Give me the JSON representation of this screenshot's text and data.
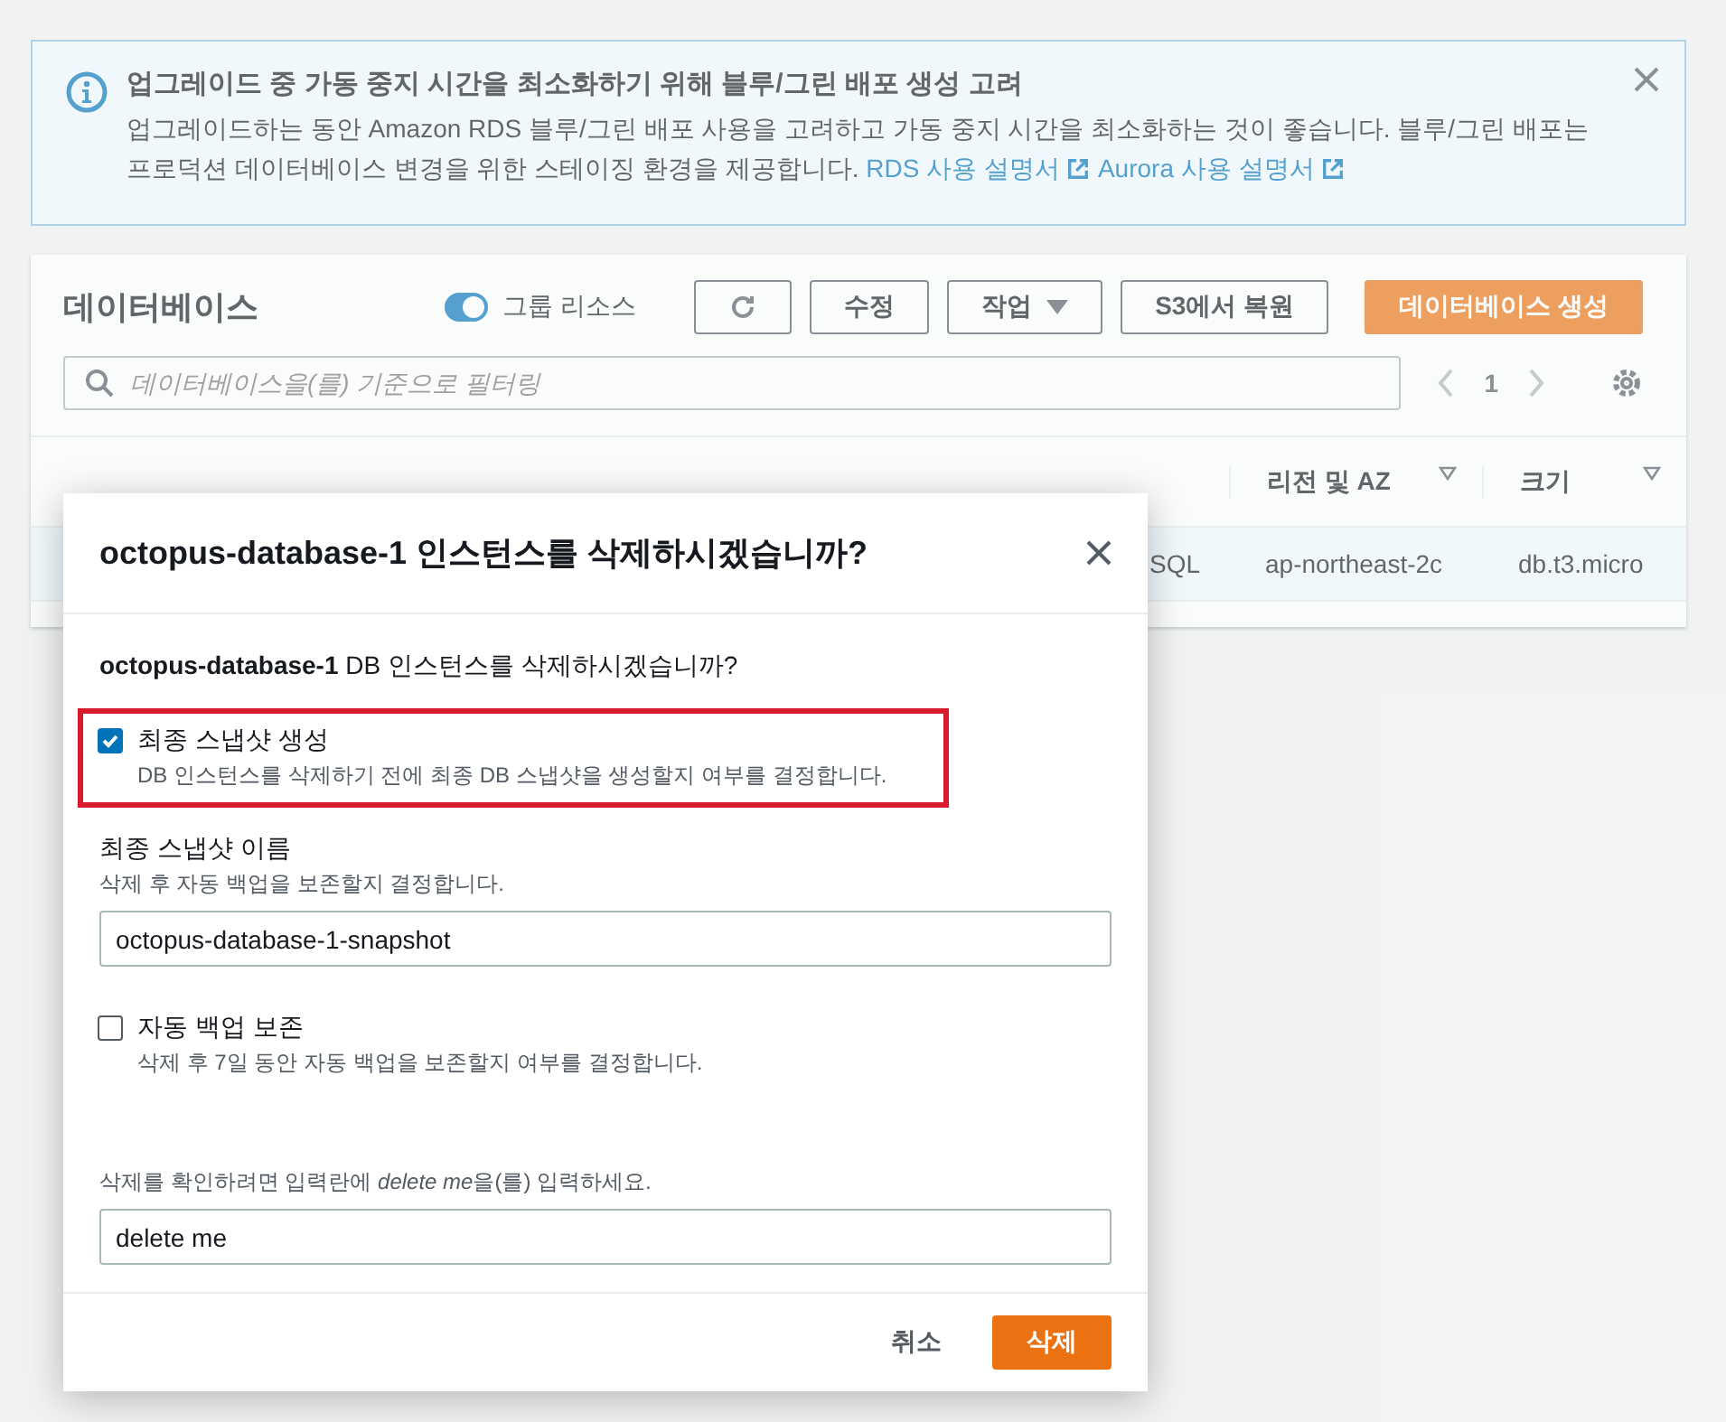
{
  "alert": {
    "title": "업그레이드 중 가동 중지 시간을 최소화하기 위해 블루/그린 배포 생성 고려",
    "body": "업그레이드하는 동안 Amazon RDS 블루/그린 배포 사용을 고려하고 가동 중지 시간을 최소화하는 것이 좋습니다. 블루/그린 배포는 프로덕션 데이터베이스 변경을 위한 스테이징 환경을 제공합니다.",
    "links": [
      "RDS 사용 설명서",
      "Aurora 사용 설명서"
    ]
  },
  "databases": {
    "title": "데이터베이스",
    "group_toggle": {
      "label": "그룹 리소스",
      "on": true
    },
    "buttons": [
      {
        "kind": "refresh"
      },
      {
        "kind": "plain",
        "label": "수정"
      },
      {
        "kind": "dropdown",
        "label": "작업"
      },
      {
        "kind": "plain",
        "label": "S3에서 복원"
      },
      {
        "kind": "primary",
        "label": "데이터베이스 생성"
      }
    ],
    "filter": {
      "placeholder": "데이터베이스을(를) 기준으로 필터링"
    },
    "page": "1",
    "columns": [
      "리전 및 AZ",
      "크기"
    ],
    "row": [
      "SQL",
      "ap-northeast-2c",
      "db.t3.micro"
    ]
  },
  "modal": {
    "title": "octopus-database-1 인스턴스를 삭제하시겠습니까?",
    "question": "**octopus-database-1** DB 인스턴스를 삭제하시겠습니까?",
    "final_snapshot": {
      "label": "최종 스냅샷 생성",
      "description": "DB 인스턴스를 삭제하기 전에 최종 DB 스냅샷을 생성할지 여부를 결정합니다.",
      "checked": true,
      "highlighted": true
    },
    "snapshot_name": {
      "label": "최종 스냅샷 이름",
      "description": "삭제 후 자동 백업을 보존할지 결정합니다.",
      "value": "octopus-database-1-snapshot"
    },
    "retain_backups": {
      "label": "자동 백업 보존",
      "description": "삭제 후 7일 동안 자동 백업을 보존할지 여부를 결정합니다.",
      "checked": false,
      "highlighted": false
    },
    "confirm": {
      "prompt": "삭제를 확인하려면 입력란에 ",
      "keyword": "delete me",
      "prompt_end": "을(를) 입력하세요.",
      "value": "delete me"
    },
    "buttons": [
      {
        "kind": "link",
        "label": "취소"
      },
      {
        "kind": "primary",
        "label": "삭제"
      }
    ]
  }
}
